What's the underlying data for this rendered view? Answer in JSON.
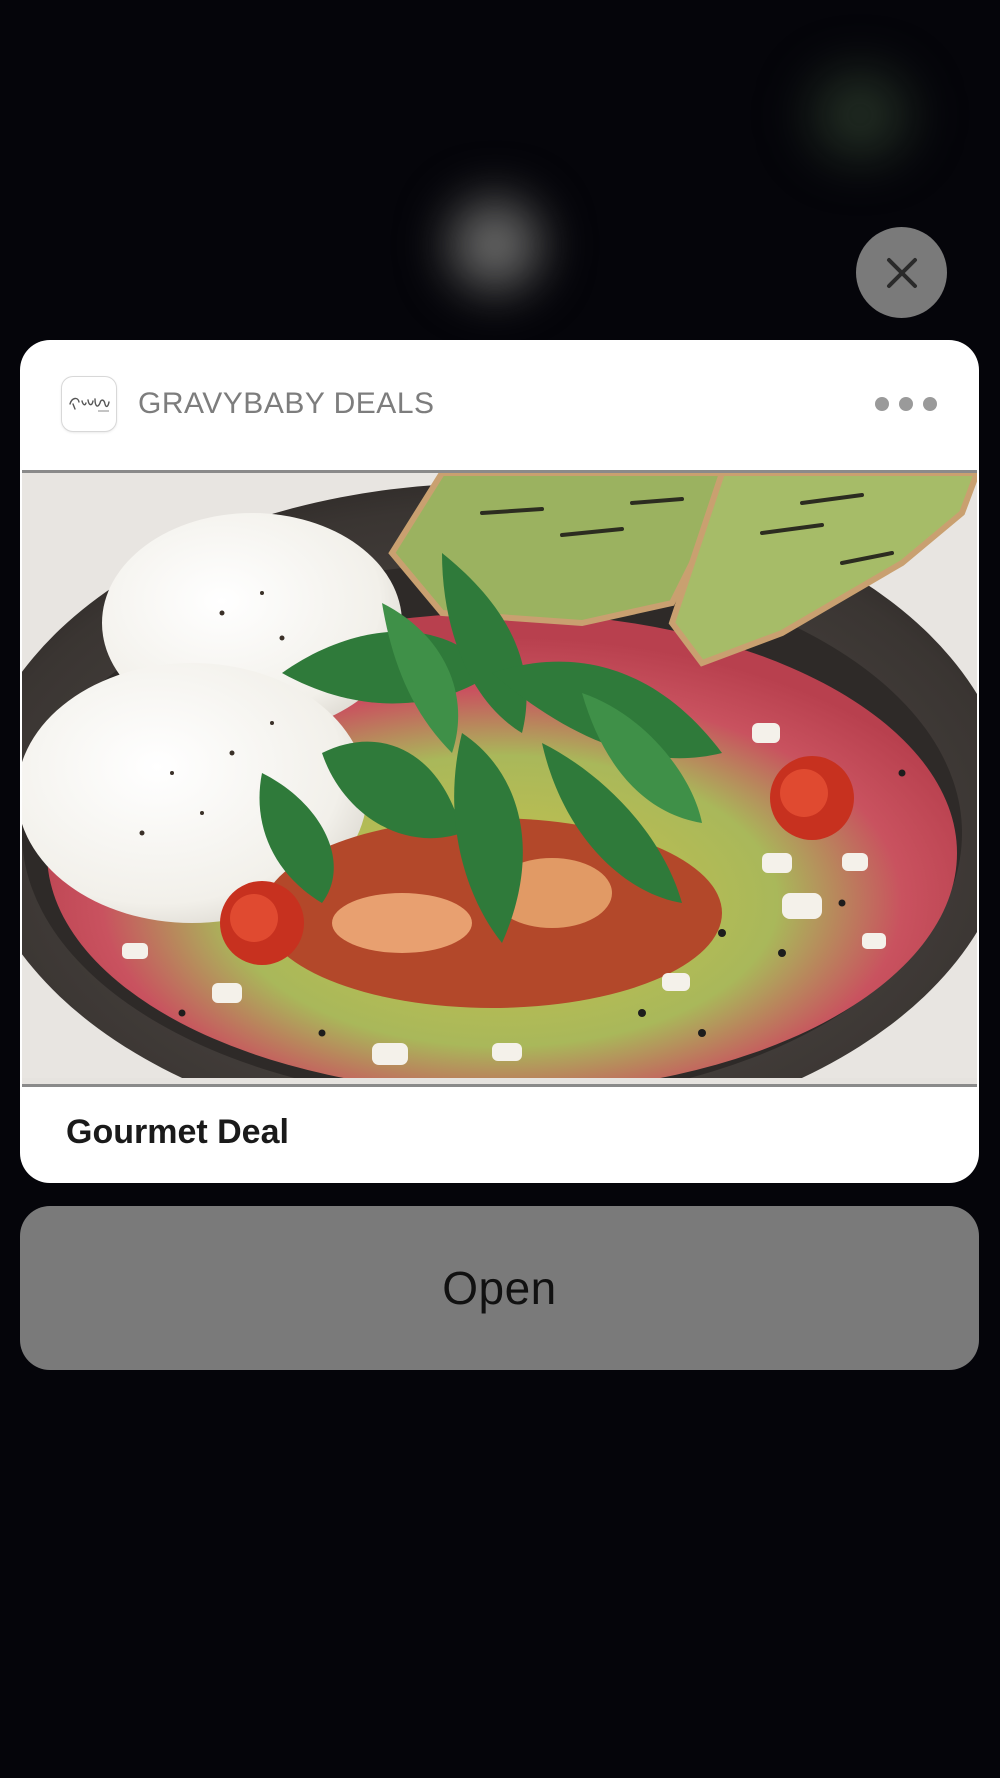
{
  "notification": {
    "app_name": "GRAVYBABY DEALS",
    "app_icon": "gravybaby-logo",
    "title": "Gourmet Deal",
    "image": "food-photo-dish"
  },
  "actions": {
    "open_label": "Open",
    "close_icon": "close-icon",
    "more_icon": "more-options-icon"
  },
  "colors": {
    "background": "#05050a",
    "card": "#ffffff",
    "button": "#7a7a7a",
    "app_name_text": "#7d7d7d"
  }
}
